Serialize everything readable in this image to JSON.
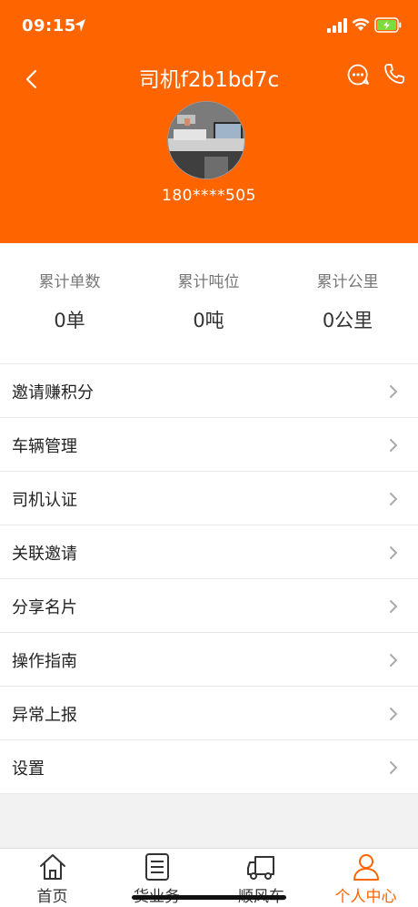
{
  "status_bar": {
    "time": "09:15"
  },
  "header": {
    "title": "司机f2b1bd7c",
    "phone": "180****505",
    "accent_color": "#fe6400"
  },
  "stats": [
    {
      "label": "累计单数",
      "value": "0单"
    },
    {
      "label": "累计吨位",
      "value": "0吨"
    },
    {
      "label": "累计公里",
      "value": "0公里"
    }
  ],
  "menu": [
    {
      "label": "邀请赚积分"
    },
    {
      "label": "车辆管理"
    },
    {
      "label": "司机认证"
    },
    {
      "label": "关联邀请"
    },
    {
      "label": "分享名片"
    },
    {
      "label": "操作指南"
    },
    {
      "label": "异常上报"
    },
    {
      "label": "设置"
    }
  ],
  "tabs": [
    {
      "label": "首页",
      "icon": "home-icon"
    },
    {
      "label": "货业务",
      "icon": "list-icon"
    },
    {
      "label": "顺风车",
      "icon": "truck-icon"
    },
    {
      "label": "个人中心",
      "icon": "person-icon",
      "active": true
    }
  ]
}
